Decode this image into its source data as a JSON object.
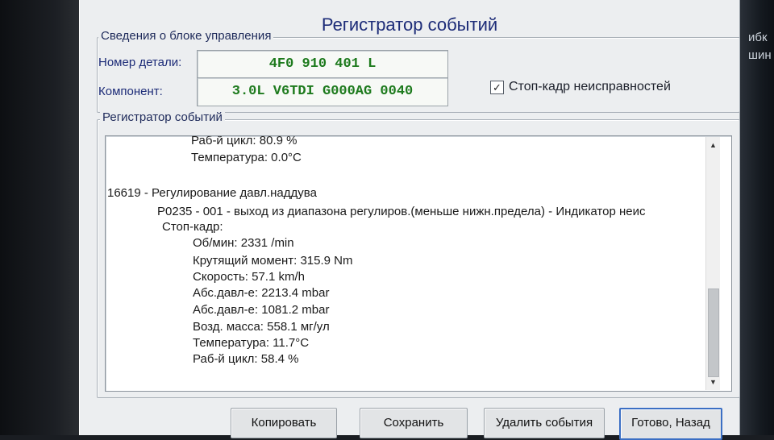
{
  "background": {
    "right_text": [
      "ибк",
      "шин"
    ]
  },
  "dialog": {
    "title": "Регистратор событий",
    "control_unit_group": {
      "label": "Сведения о блоке управления",
      "part_number_label": "Номер детали:",
      "part_number_value": "4F0 910 401 L",
      "component_label": "Компонент:",
      "component_value": "3.0L V6TDI  G000AG  0040",
      "freeze_frame_checkbox": {
        "label": "Стоп-кадр неисправностей",
        "checked": true
      }
    },
    "event_log_group": {
      "label": "Регистратор событий",
      "lines": [
        "Раб-й цикл: 80.9 %",
        "Температура: 0.0°C",
        "16619 - Регулирование давл.наддува",
        "P0235 - 001 - выход из диапазона регулиров.(меньше нижн.предела) - Индикатор неис",
        "Стоп-кадр:",
        "Об/мин: 2331 /min",
        "Крутящий момент: 315.9 Nm",
        "Скорость: 57.1 km/h",
        "Абс.давл-е: 2213.4 mbar",
        "Абс.давл-е: 1081.2 mbar",
        "Возд. масса: 558.1 мг/ул",
        "Температура: 11.7°C",
        "Раб-й цикл: 58.4 %"
      ]
    },
    "buttons": {
      "copy": "Копировать",
      "save": "Сохранить",
      "delete_events": "Удалить события",
      "done_back": "Готово, Назад"
    }
  },
  "colors": {
    "title": "#1d2c78",
    "field_value": "#1d7a1d",
    "dialog_bg": "#eceef0"
  }
}
